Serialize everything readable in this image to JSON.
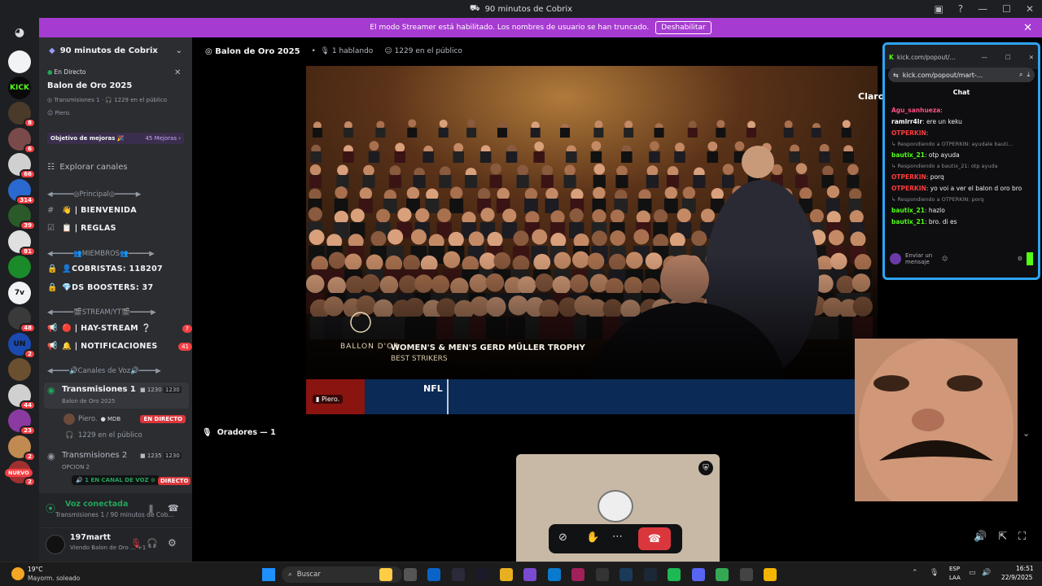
{
  "window": {
    "title": "90 minutos de Cobrix"
  },
  "banner": {
    "text": "El modo Streamer está habilitado. Los nombres de usuario se han truncado.",
    "button": "Deshabilitar"
  },
  "rail": {
    "items": [
      {
        "label": "",
        "badge": ""
      },
      {
        "label": "KICK",
        "badge": ""
      },
      {
        "label": "",
        "badge": "8"
      },
      {
        "label": "",
        "badge": "6"
      },
      {
        "label": "",
        "badge": "66"
      },
      {
        "label": "",
        "badge": "314"
      },
      {
        "label": "",
        "badge": "39"
      },
      {
        "label": "",
        "badge": "81"
      },
      {
        "label": "",
        "badge": ""
      },
      {
        "label": "7v",
        "badge": ""
      },
      {
        "label": "",
        "badge": "48"
      },
      {
        "label": "UN",
        "badge": "2"
      },
      {
        "label": "",
        "badge": ""
      },
      {
        "label": "",
        "badge": "44"
      },
      {
        "label": "",
        "badge": "23"
      },
      {
        "label": "",
        "badge": "2"
      },
      {
        "label": "",
        "badge": "2"
      }
    ],
    "new_label": "NUEVO"
  },
  "sidebar": {
    "server_name": "90 minutos de Cobrix",
    "live": {
      "tag": "En Directo",
      "title": "Balon de Oro 2025",
      "meta": "Transmisiones 1 · 🎧 1229 en el público",
      "user": "Piero."
    },
    "boost": {
      "label": "Objetivo de mejoras 🎉",
      "count": "45 Mejoras ›"
    },
    "explore": "Explorar canales",
    "items": [
      {
        "kind": "cat",
        "text": "◀━━━━━◎Principal◎━━━━━▶"
      },
      {
        "kind": "ch",
        "icon": "#",
        "text": "👋 | BIENVENIDA"
      },
      {
        "kind": "ch",
        "icon": "☑",
        "text": "📋 | REGLAS"
      },
      {
        "kind": "cat",
        "text": "◀━━━━━👥MIEMBROS👥━━━━━▶"
      },
      {
        "kind": "ch",
        "icon": "🔒",
        "text": "👤COBRISTAS: 118207"
      },
      {
        "kind": "ch",
        "icon": "🔒",
        "text": "💎DS BOOSTERS: 37"
      },
      {
        "kind": "cat",
        "text": "◀━━━━━🎬STREAM/YT🎬━━━━━▶"
      },
      {
        "kind": "ch",
        "icon": "📢",
        "text": "🔴 | HAY-STREAM ❔",
        "count": "7"
      },
      {
        "kind": "ch",
        "icon": "📢",
        "text": "🔔 | NOTIFICACIONES",
        "count": "41"
      },
      {
        "kind": "cat",
        "text": "◀━━━━🔊Canales de Voz🔊━━━━▶"
      }
    ],
    "voice1": {
      "name": "Transmisiones 1",
      "sub": "Balon de Oro 2025",
      "users": "1230",
      "cap": "1230"
    },
    "voice1_user": {
      "name": "Piero.",
      "tag": "MDB",
      "live": "EN DIRECTO"
    },
    "voice1_audience": "1229 en el público",
    "voice2": {
      "name": "Transmisiones 2",
      "sub": "OPCION 2",
      "users": "1235",
      "cap": "1230"
    },
    "voice2_tip": "1 EN CANAL DE VOZ",
    "voice2_live": "DIRECTO"
  },
  "voice_status": {
    "title": "Voz conectada",
    "sub": "Transmisiones 1 / 90 minutos de Cob..."
  },
  "user": {
    "name": "197martt",
    "status": "Viendo Balon de Oro ... +1"
  },
  "main": {
    "title": "Balon de Oro 2025",
    "speaking": "1 hablando",
    "audience": "1229 en el público",
    "speakers_label": "Oradores — 1",
    "stream_caption": "WOMEN'S & MEN'S GERD MÜLLER TROPHY",
    "stream_sub": "BEST STRIKERS",
    "stream_logo": "BALLON D'OR",
    "ticker": "NFL",
    "streamer_tag": "Piero.",
    "brand": "Claro"
  },
  "kick": {
    "url": "kick.com/popout/mart-...",
    "tab_url": "kick.com/popout/...",
    "tab": "Chat",
    "messages": [
      {
        "user": "Agu_sanhueza",
        "color": "#ff4f81",
        "text": ""
      },
      {
        "user": "ramlrr4lr",
        "color": "#ffffff",
        "text": "ere un keku"
      },
      {
        "user": "OTPERKIN",
        "color": "#ff3b3b",
        "text": ""
      },
      {
        "reply": "Respondiendo a OTPERKIN: ayudale bauti..."
      },
      {
        "user": "bautix_21",
        "color": "#53fc18",
        "text": "otp ayuda"
      },
      {
        "reply": "Respondiendo a bautix_21: otp ayuda"
      },
      {
        "user": "OTPERKIN",
        "color": "#ff3b3b",
        "text": "porq"
      },
      {
        "user": "OTPERKIN",
        "color": "#ff3b3b",
        "text": "yo voi a ver el balon d oro bro"
      },
      {
        "reply": "Respondiendo a OTPERKIN: porq"
      },
      {
        "user": "bautix_21",
        "color": "#53fc18",
        "text": "hazlo"
      },
      {
        "user": "bautix_21",
        "color": "#53fc18",
        "text": "bro. di es"
      }
    ],
    "input_placeholder": "Enviar un mensaje"
  },
  "taskbar": {
    "weather_temp": "19°C",
    "weather_desc": "Mayorm. soleado",
    "search": "Buscar",
    "lang": "ESP",
    "lang2": "LAA",
    "time": "16:51",
    "date": "22/9/2025"
  }
}
